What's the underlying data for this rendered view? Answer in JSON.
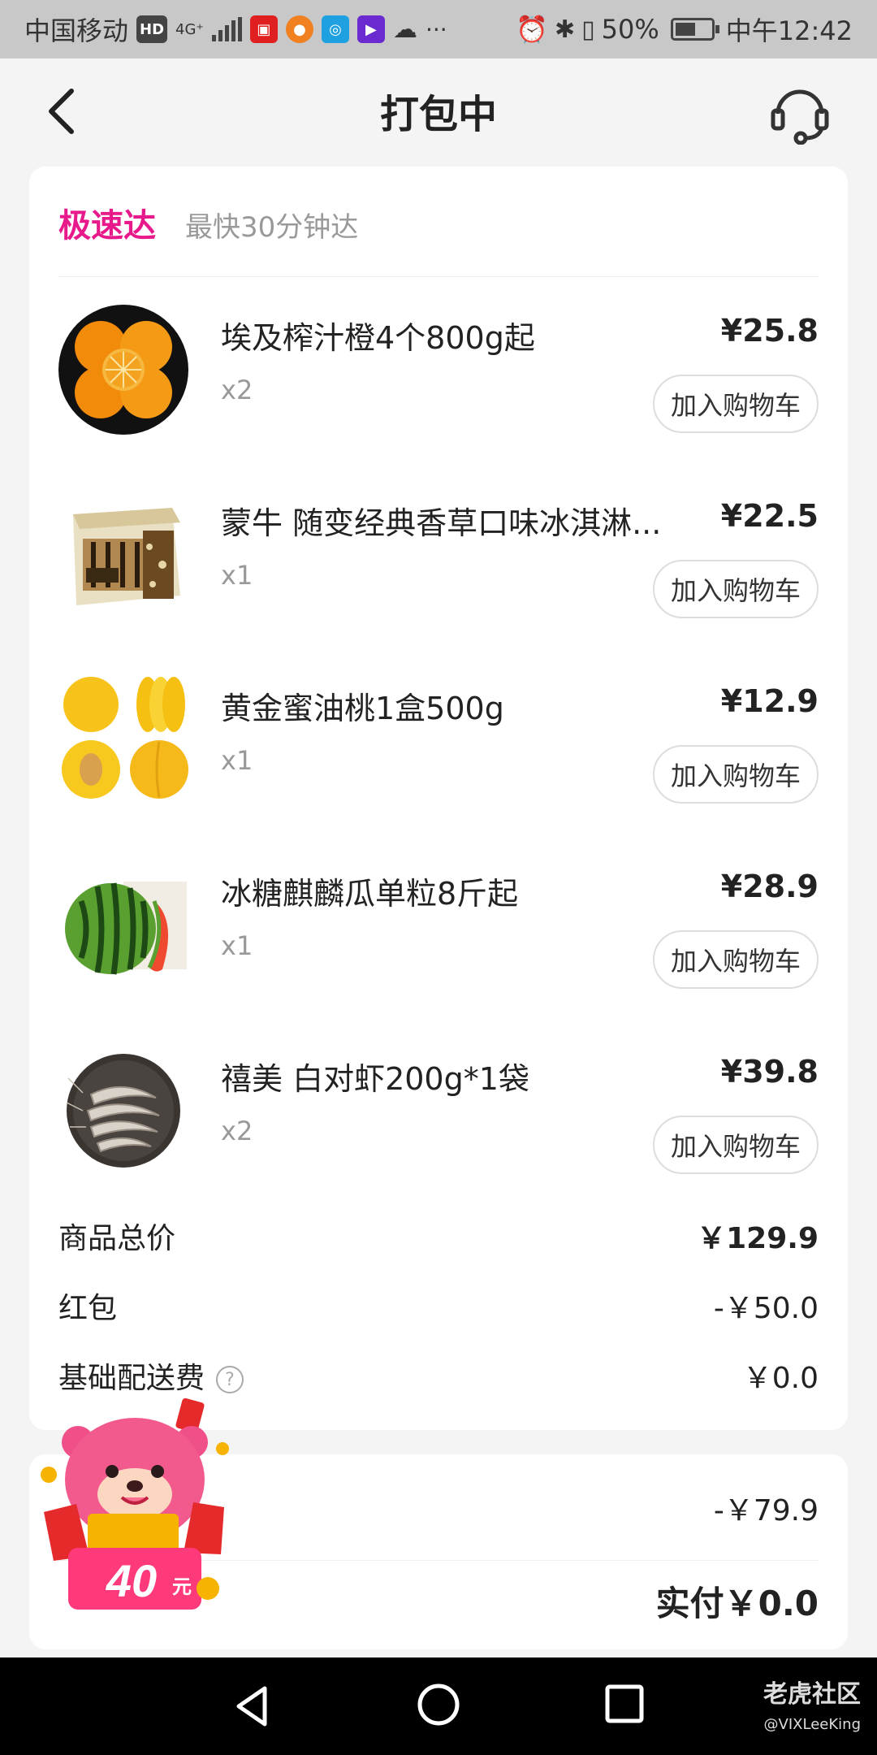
{
  "status_bar": {
    "carrier": "中国移动",
    "hd": "HD",
    "net": "4G⁺",
    "battery": "50%",
    "time": "中午12:42"
  },
  "header": {
    "title": "打包中"
  },
  "delivery": {
    "type": "极速达",
    "desc": "最快30分钟达"
  },
  "items": [
    {
      "name": "埃及榨汁橙4个800g起",
      "price": "¥25.8",
      "qty": "x2",
      "button": "加入购物车"
    },
    {
      "name": "蒙牛 随变经典香草口味冰淇淋...",
      "price": "¥22.5",
      "qty": "x1",
      "button": "加入购物车"
    },
    {
      "name": "黄金蜜油桃1盒500g",
      "price": "¥12.9",
      "qty": "x1",
      "button": "加入购物车"
    },
    {
      "name": "冰糖麒麟瓜单粒8斤起",
      "price": "¥28.9",
      "qty": "x1",
      "button": "加入购物车"
    },
    {
      "name": "禧美 白对虾200g*1袋",
      "price": "¥39.8",
      "qty": "x2",
      "button": "加入购物车"
    }
  ],
  "summary": {
    "total_label": "商品总价",
    "total_value": "￥129.9",
    "redpack_label": "红包",
    "redpack_value": "-￥50.0",
    "shipping_label": "基础配送费",
    "shipping_value": "￥0.0",
    "help_glyph": "?"
  },
  "payment": {
    "discount_value": "-￥79.9",
    "paid": "实付￥0.0"
  },
  "promo": {
    "badge": "40元"
  },
  "watermark": {
    "line1": "老虎社区",
    "line2": "@VIXLeeKing"
  },
  "colors": {
    "accent": "#e8198b",
    "background": "#f4f4f4"
  }
}
